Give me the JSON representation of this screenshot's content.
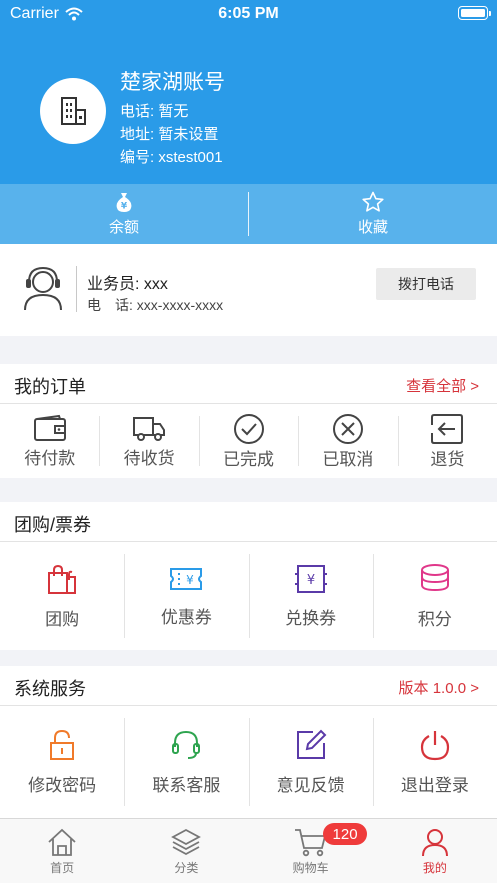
{
  "status_bar": {
    "carrier": "Carrier",
    "time": "6:05 PM"
  },
  "account": {
    "name": "楚家湖账号",
    "phone": "电话: 暂无",
    "address": "地址: 暂未设置",
    "code": "编号: xstest001"
  },
  "tabs": [
    {
      "label": "余额",
      "icon": "money-bag-icon"
    },
    {
      "label": "收藏",
      "icon": "star-icon"
    }
  ],
  "salesman": {
    "name": "业务员: xxx",
    "phone": "电　话: xxx-xxxx-xxxx",
    "call_label": "拨打电话"
  },
  "orders": {
    "title": "我的订单",
    "link": "查看全部 >",
    "items": [
      {
        "label": "待付款",
        "icon": "wallet-icon"
      },
      {
        "label": "待收货",
        "icon": "truck-icon"
      },
      {
        "label": "已完成",
        "icon": "check-circle-icon"
      },
      {
        "label": "已取消",
        "icon": "x-circle-icon"
      },
      {
        "label": "退货",
        "icon": "return-icon"
      }
    ]
  },
  "group": {
    "title": "团购/票券",
    "items": [
      {
        "label": "团购",
        "icon": "shopping-bags-icon",
        "color": "#d6343b"
      },
      {
        "label": "优惠券",
        "icon": "coupon-icon",
        "color": "#2a9be8"
      },
      {
        "label": "兑换券",
        "icon": "voucher-icon",
        "color": "#5a3aa8"
      },
      {
        "label": "积分",
        "icon": "coins-icon",
        "color": "#e0378a"
      }
    ]
  },
  "services": {
    "title": "系统服务",
    "link": "版本 1.0.0 >",
    "items": [
      {
        "label": "修改密码",
        "icon": "lock-icon",
        "color": "#f07a2a"
      },
      {
        "label": "联系客服",
        "icon": "headset-icon",
        "color": "#2ea44f"
      },
      {
        "label": "意见反馈",
        "icon": "edit-icon",
        "color": "#5a3aa8"
      },
      {
        "label": "退出登录",
        "icon": "power-icon",
        "color": "#d6343b"
      }
    ]
  },
  "tabbar": [
    {
      "label": "首页",
      "icon": "home-icon"
    },
    {
      "label": "分类",
      "icon": "layers-icon"
    },
    {
      "label": "购物车",
      "icon": "cart-icon",
      "badge": "120"
    },
    {
      "label": "我的",
      "icon": "person-icon",
      "active": true
    }
  ],
  "colors": {
    "header": "#2a9be8",
    "accent": "#d6343b"
  }
}
